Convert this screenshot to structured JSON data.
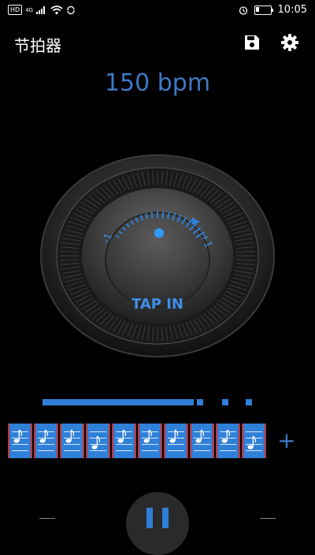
{
  "status_bar": {
    "network_label": "HD",
    "signal_label": "4G",
    "battery_level": 0.25,
    "time": "10:05"
  },
  "app_bar": {
    "title": "节拍器",
    "save_icon": "save-icon",
    "settings_icon": "gear-icon"
  },
  "tempo": {
    "bpm_text": "150 bpm"
  },
  "dial": {
    "minus_label": "-1",
    "plus_label": "+1",
    "tap_label": "TAP IN",
    "accent_color": "#2f7fd8"
  },
  "beat_indicator": {
    "progress": 0.64,
    "dots": 4
  },
  "notes": {
    "count": 10,
    "add_label": "+"
  },
  "play_control": {
    "icon": "pause-icon"
  }
}
